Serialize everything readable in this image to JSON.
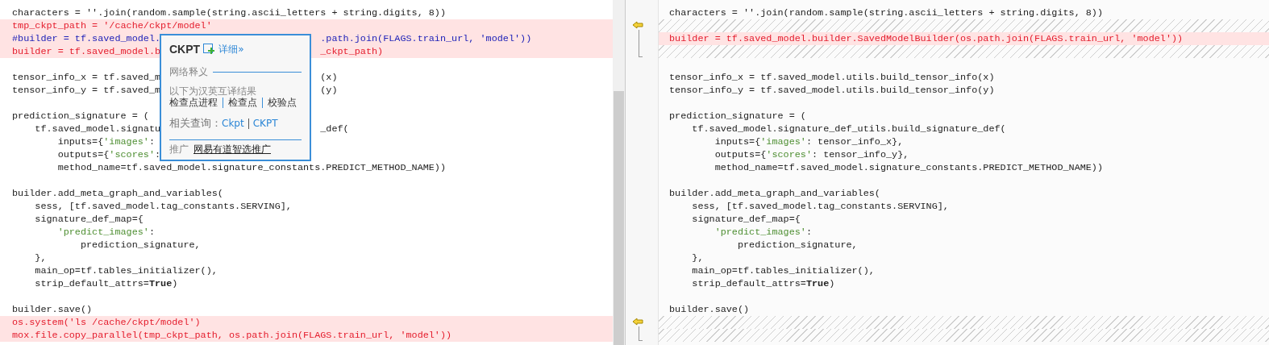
{
  "left_pane": {
    "lines": [
      {
        "kind": "same",
        "parts": [
          {
            "kind": "plain",
            "text": "characters = ''.join(random.sample(string.ascii_letters + string.digits, 8))"
          }
        ]
      },
      {
        "kind": "removed",
        "parts": [
          {
            "kind": "removed",
            "text": "tmp_ckpt_path = '/cache/ckpt/model'"
          }
        ]
      },
      {
        "kind": "removed",
        "parts": [
          {
            "kind": "comment",
            "text": "#builder = tf.saved_model."
          }
        ],
        "after": [
          {
            "kind": "comment",
            "text": ".path.join(FLAGS.train_url, 'model'))"
          }
        ]
      },
      {
        "kind": "removed",
        "parts": [
          {
            "kind": "removed",
            "text": "builder = tf.saved_model.b"
          }
        ],
        "after": [
          {
            "kind": "removed",
            "text": "_ckpt_path)"
          }
        ]
      },
      {
        "kind": "blank"
      },
      {
        "kind": "same",
        "parts": [
          {
            "kind": "plain",
            "text": "tensor_info_x = tf.saved_m"
          }
        ],
        "after": [
          {
            "kind": "plain",
            "text": "(x)"
          }
        ]
      },
      {
        "kind": "same",
        "parts": [
          {
            "kind": "plain",
            "text": "tensor_info_y = tf.saved_m"
          }
        ],
        "after": [
          {
            "kind": "plain",
            "text": "(y)"
          }
        ]
      },
      {
        "kind": "blank"
      },
      {
        "kind": "same",
        "parts": [
          {
            "kind": "plain",
            "text": "prediction_signature = ("
          }
        ]
      },
      {
        "kind": "same",
        "parts": [
          {
            "kind": "plain",
            "text": "    tf.saved_model.signatu"
          }
        ],
        "after": [
          {
            "kind": "plain",
            "text": "_def("
          }
        ]
      },
      {
        "kind": "same",
        "parts": [
          {
            "kind": "plain",
            "text": "        inputs={"
          },
          {
            "kind": "string",
            "text": "'images'"
          },
          {
            "kind": "plain",
            "text": ":"
          }
        ]
      },
      {
        "kind": "same",
        "parts": [
          {
            "kind": "plain",
            "text": "        outputs={"
          },
          {
            "kind": "string",
            "text": "'scores'"
          },
          {
            "kind": "plain",
            "text": ":"
          }
        ]
      },
      {
        "kind": "same",
        "parts": [
          {
            "kind": "plain",
            "text": "        method_name=tf.saved_model.signature_constants.PREDICT_METHOD_NAME))"
          }
        ]
      },
      {
        "kind": "blank"
      },
      {
        "kind": "same",
        "parts": [
          {
            "kind": "plain",
            "text": "builder.add_meta_graph_and_variables("
          }
        ]
      },
      {
        "kind": "same",
        "parts": [
          {
            "kind": "plain",
            "text": "    sess, [tf.saved_model.tag_constants.SERVING],"
          }
        ]
      },
      {
        "kind": "same",
        "parts": [
          {
            "kind": "plain",
            "text": "    signature_def_map={"
          }
        ]
      },
      {
        "kind": "same",
        "parts": [
          {
            "kind": "string",
            "text": "        'predict_images'"
          },
          {
            "kind": "plain",
            "text": ":"
          }
        ]
      },
      {
        "kind": "same",
        "parts": [
          {
            "kind": "plain",
            "text": "            prediction_signature,"
          }
        ]
      },
      {
        "kind": "same",
        "parts": [
          {
            "kind": "plain",
            "text": "    },"
          }
        ]
      },
      {
        "kind": "same",
        "parts": [
          {
            "kind": "plain",
            "text": "    main_op=tf.tables_initializer(),"
          }
        ]
      },
      {
        "kind": "same",
        "parts": [
          {
            "kind": "plain",
            "text": "    strip_default_attrs="
          },
          {
            "kind": "bold",
            "text": "True"
          },
          {
            "kind": "plain",
            "text": ")"
          }
        ]
      },
      {
        "kind": "blank"
      },
      {
        "kind": "same",
        "parts": [
          {
            "kind": "plain",
            "text": "builder.save()"
          }
        ]
      },
      {
        "kind": "removed",
        "parts": [
          {
            "kind": "removed",
            "text": "os.system('ls /cache/ckpt/model')"
          }
        ]
      },
      {
        "kind": "removed",
        "parts": [
          {
            "kind": "removed",
            "text": "mox.file.copy_parallel(tmp_ckpt_path, os.path.join(FLAGS.train_url, 'model'))"
          }
        ]
      }
    ]
  },
  "right_pane": {
    "lines": [
      {
        "kind": "same",
        "parts": [
          {
            "kind": "plain",
            "text": "characters = ''.join(random.sample(string.ascii_letters + string.digits, 8))"
          }
        ]
      },
      {
        "kind": "hatch"
      },
      {
        "kind": "changed",
        "parts": [
          {
            "kind": "removed",
            "text": "builder = tf.saved_model.builder.SavedModelBuilder(os.path.join(FLAGS.train_url, 'model'))"
          }
        ]
      },
      {
        "kind": "hatch"
      },
      {
        "kind": "blank"
      },
      {
        "kind": "same",
        "parts": [
          {
            "kind": "plain",
            "text": "tensor_info_x = tf.saved_model.utils.build_tensor_info(x)"
          }
        ]
      },
      {
        "kind": "same",
        "parts": [
          {
            "kind": "plain",
            "text": "tensor_info_y = tf.saved_model.utils.build_tensor_info(y)"
          }
        ]
      },
      {
        "kind": "blank"
      },
      {
        "kind": "same",
        "parts": [
          {
            "kind": "plain",
            "text": "prediction_signature = ("
          }
        ]
      },
      {
        "kind": "same",
        "parts": [
          {
            "kind": "plain",
            "text": "    tf.saved_model.signature_def_utils.build_signature_def("
          }
        ]
      },
      {
        "kind": "same",
        "parts": [
          {
            "kind": "plain",
            "text": "        inputs={"
          },
          {
            "kind": "string",
            "text": "'images'"
          },
          {
            "kind": "plain",
            "text": ": tensor_info_x},"
          }
        ]
      },
      {
        "kind": "same",
        "parts": [
          {
            "kind": "plain",
            "text": "        outputs={"
          },
          {
            "kind": "string",
            "text": "'scores'"
          },
          {
            "kind": "plain",
            "text": ": tensor_info_y},"
          }
        ]
      },
      {
        "kind": "same",
        "parts": [
          {
            "kind": "plain",
            "text": "        method_name=tf.saved_model.signature_constants.PREDICT_METHOD_NAME))"
          }
        ]
      },
      {
        "kind": "blank"
      },
      {
        "kind": "same",
        "parts": [
          {
            "kind": "plain",
            "text": "builder.add_meta_graph_and_variables("
          }
        ]
      },
      {
        "kind": "same",
        "parts": [
          {
            "kind": "plain",
            "text": "    sess, [tf.saved_model.tag_constants.SERVING],"
          }
        ]
      },
      {
        "kind": "same",
        "parts": [
          {
            "kind": "plain",
            "text": "    signature_def_map={"
          }
        ]
      },
      {
        "kind": "same",
        "parts": [
          {
            "kind": "string",
            "text": "        'predict_images'"
          },
          {
            "kind": "plain",
            "text": ":"
          }
        ]
      },
      {
        "kind": "same",
        "parts": [
          {
            "kind": "plain",
            "text": "            prediction_signature,"
          }
        ]
      },
      {
        "kind": "same",
        "parts": [
          {
            "kind": "plain",
            "text": "    },"
          }
        ]
      },
      {
        "kind": "same",
        "parts": [
          {
            "kind": "plain",
            "text": "    main_op=tf.tables_initializer(),"
          }
        ]
      },
      {
        "kind": "same",
        "parts": [
          {
            "kind": "plain",
            "text": "    strip_default_attrs="
          },
          {
            "kind": "bold",
            "text": "True"
          },
          {
            "kind": "plain",
            "text": ")"
          }
        ]
      },
      {
        "kind": "blank"
      },
      {
        "kind": "same",
        "parts": [
          {
            "kind": "plain",
            "text": "builder.save()"
          }
        ]
      },
      {
        "kind": "hatch"
      },
      {
        "kind": "hatch"
      }
    ]
  },
  "dictionary_popup": {
    "headword": "CKPT",
    "detail_link": "详细»",
    "section_title": "网络释义",
    "note": "以下为汉英互译结果",
    "translations": [
      "检查点进程",
      "检查点",
      "校验点"
    ],
    "related_label": "相关查询：",
    "related": [
      "Ckpt",
      "CKPT"
    ],
    "promo_label": "推广",
    "promo_link": "网易有道智选推广"
  }
}
